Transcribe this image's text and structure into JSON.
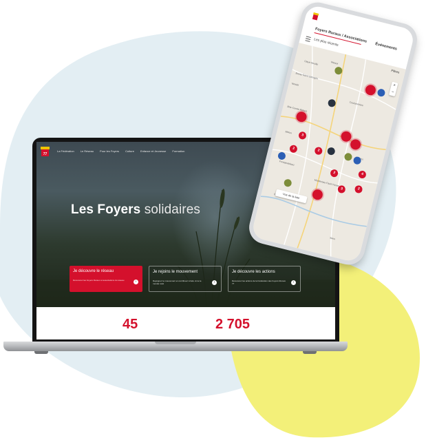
{
  "laptop": {
    "nav": [
      "La Fédération",
      "Le Réseau",
      "Pour les Foyers",
      "Culture",
      "Enfance et Jeunesse",
      "Formation"
    ],
    "hero_title_bold": "Les Foyers",
    "hero_title_light": "solidaires",
    "cards": [
      {
        "title": "Je découvre le réseau",
        "desc": "Découvrez les Foyers Ruraux et associations du réseau"
      },
      {
        "title": "Je rejoins le mouvement",
        "desc": "Rejoignez le mouvement et contribuez à faire vivre le monde rural"
      },
      {
        "title": "Je découvre les actions",
        "desc": "Découvrez les actions de la Fédération des Foyers Ruraux 77"
      }
    ],
    "stats": [
      "45",
      "2 705"
    ]
  },
  "phone": {
    "tab_associations": "Foyers Ruraux / Associations",
    "tab_events": "Événements",
    "recent": "Les plus récents",
    "filters": "Filtres",
    "view_button": "Vue de la liste",
    "places": [
      "Claye-Souilly",
      "Meaux",
      "Bussy-Saint-Georges",
      "Noisiel",
      "Coulommiers",
      "Brie-Comte-Robert",
      "Melun",
      "Fontainebleau",
      "Montereau-Fault-Yonne",
      "Provins",
      "Nemours",
      "Sens"
    ],
    "pins": [
      "3",
      "2",
      "2",
      "4",
      "2",
      "2",
      "3"
    ]
  },
  "colors": {
    "brand_red": "#d4102c",
    "bg_blue": "#e3eef3",
    "bg_yellow": "#f3f079"
  }
}
